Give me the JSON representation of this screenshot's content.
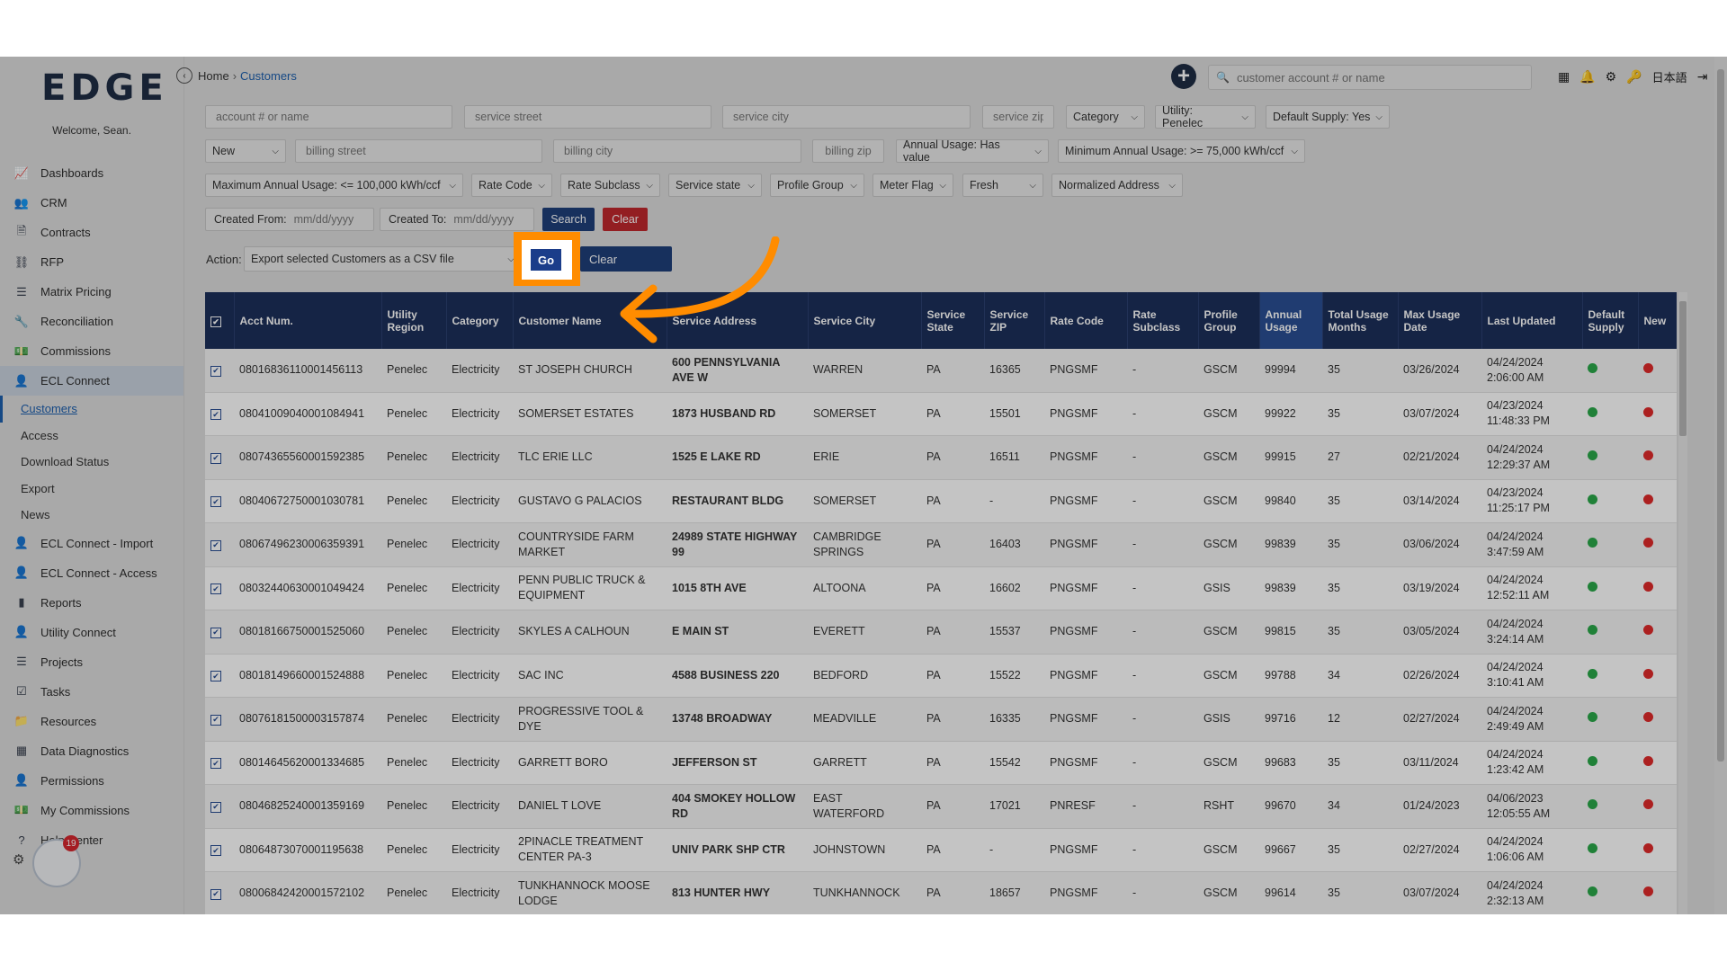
{
  "sidebar": {
    "logo": "EDGE",
    "welcome": "Welcome, Sean.",
    "items": [
      {
        "label": "Dashboards",
        "icon": "chart-icon"
      },
      {
        "label": "CRM",
        "icon": "people-icon"
      },
      {
        "label": "Contracts",
        "icon": "document-icon"
      },
      {
        "label": "RFP",
        "icon": "network-icon"
      },
      {
        "label": "Matrix Pricing",
        "icon": "list-icon"
      },
      {
        "label": "Reconciliation",
        "icon": "wrench-icon"
      },
      {
        "label": "Commissions",
        "icon": "money-icon"
      },
      {
        "label": "ECL Connect",
        "icon": "user-group-icon"
      }
    ],
    "sub_items": [
      "Customers",
      "Access",
      "Download Status",
      "Export",
      "News"
    ],
    "items2": [
      {
        "label": "ECL Connect - Import",
        "icon": "user-group-icon"
      },
      {
        "label": "ECL Connect - Access",
        "icon": "user-group-icon"
      },
      {
        "label": "Reports",
        "icon": "bar-chart-icon"
      },
      {
        "label": "Utility Connect",
        "icon": "user-icon"
      },
      {
        "label": "Projects",
        "icon": "list-icon"
      },
      {
        "label": "Tasks",
        "icon": "check-icon"
      },
      {
        "label": "Resources",
        "icon": "folder-icon"
      },
      {
        "label": "Data Diagnostics",
        "icon": "table-icon"
      },
      {
        "label": "Permissions",
        "icon": "user-lock-icon"
      },
      {
        "label": "My Commissions",
        "icon": "money-icon"
      },
      {
        "label": "Help Center",
        "icon": "question-icon"
      }
    ],
    "notification_count": "19"
  },
  "header": {
    "breadcrumb_home": "Home",
    "breadcrumb_sep": "›",
    "breadcrumb_current": "Customers",
    "search_placeholder": "customer account # or name",
    "language": "日本語"
  },
  "filters": {
    "account_placeholder": "account # or name",
    "service_street_placeholder": "service street",
    "service_city_placeholder": "service city",
    "service_zip_placeholder": "service zip",
    "category": "Category",
    "utility": "Utility: Penelec",
    "default_supply": "Default Supply: Yes",
    "new_select": "New",
    "billing_street_placeholder": "billing street",
    "billing_city_placeholder": "billing city",
    "billing_zip_placeholder": "billing zip",
    "annual_usage": "Annual Usage: Has value",
    "min_annual_usage": "Minimum Annual Usage: >= 75,000 kWh/ccf",
    "max_annual_usage": "Maximum Annual Usage: <= 100,000 kWh/ccf",
    "rate_code": "Rate Code",
    "rate_subclass": "Rate Subclass",
    "service_state": "Service state",
    "profile_group": "Profile Group",
    "meter_flag": "Meter Flag",
    "fresh": "Fresh",
    "normalized_address": "Normalized Address",
    "created_from_label": "Created From:",
    "created_to_label": "Created To:",
    "date_placeholder": "mm/dd/yyyy",
    "search_button": "Search",
    "clear_button": "Clear"
  },
  "action": {
    "label": "Action:",
    "selected": "Export selected Customers as a CSV file",
    "go_button": "Go",
    "clear_button": "Clear"
  },
  "table": {
    "headers": [
      "Acct Num.",
      "Utility Region",
      "Category",
      "Customer Name",
      "Service Address",
      "Service City",
      "Service State",
      "Service ZIP",
      "Rate Code",
      "Rate Subclass",
      "Profile Group",
      "Annual Usage",
      "Total Usage Months",
      "Max Usage Date",
      "Last Updated",
      "Default Supply",
      "New"
    ],
    "rows": [
      {
        "acct": "08016836110001456113",
        "region": "Penelec",
        "category": "Electricity",
        "name": "ST JOSEPH CHURCH",
        "address": "600 PENNSYLVANIA AVE W",
        "city": "WARREN",
        "state": "PA",
        "zip": "16365",
        "rate": "PNGSMF",
        "subclass": "-",
        "profile": "GSCM",
        "usage": "99994",
        "months": "35",
        "max_date": "03/26/2024",
        "updated": "04/24/2024 2:06:00 AM"
      },
      {
        "acct": "08041009040001084941",
        "region": "Penelec",
        "category": "Electricity",
        "name": "SOMERSET ESTATES",
        "address": "1873 HUSBAND RD",
        "city": "SOMERSET",
        "state": "PA",
        "zip": "15501",
        "rate": "PNGSMF",
        "subclass": "-",
        "profile": "GSCM",
        "usage": "99922",
        "months": "35",
        "max_date": "03/07/2024",
        "updated": "04/23/2024 11:48:33 PM"
      },
      {
        "acct": "08074365560001592385",
        "region": "Penelec",
        "category": "Electricity",
        "name": "TLC ERIE LLC",
        "address": "1525 E LAKE RD",
        "city": "ERIE",
        "state": "PA",
        "zip": "16511",
        "rate": "PNGSMF",
        "subclass": "-",
        "profile": "GSCM",
        "usage": "99915",
        "months": "27",
        "max_date": "02/21/2024",
        "updated": "04/24/2024 12:29:37 AM"
      },
      {
        "acct": "08040672750001030781",
        "region": "Penelec",
        "category": "Electricity",
        "name": "GUSTAVO G PALACIOS",
        "address": "RESTAURANT BLDG",
        "city": "SOMERSET",
        "state": "PA",
        "zip": "-",
        "rate": "PNGSMF",
        "subclass": "-",
        "profile": "GSCM",
        "usage": "99840",
        "months": "35",
        "max_date": "03/14/2024",
        "updated": "04/23/2024 11:25:17 PM"
      },
      {
        "acct": "08067496230006359391",
        "region": "Penelec",
        "category": "Electricity",
        "name": "COUNTRYSIDE FARM MARKET",
        "address": "24989 STATE HIGHWAY 99",
        "city": "CAMBRIDGE SPRINGS",
        "state": "PA",
        "zip": "16403",
        "rate": "PNGSMF",
        "subclass": "-",
        "profile": "GSCM",
        "usage": "99839",
        "months": "35",
        "max_date": "03/06/2024",
        "updated": "04/24/2024 3:47:59 AM"
      },
      {
        "acct": "08032440630001049424",
        "region": "Penelec",
        "category": "Electricity",
        "name": "PENN PUBLIC TRUCK & EQUIPMENT",
        "address": "1015 8TH AVE",
        "city": "ALTOONA",
        "state": "PA",
        "zip": "16602",
        "rate": "PNGSMF",
        "subclass": "-",
        "profile": "GSIS",
        "usage": "99839",
        "months": "35",
        "max_date": "03/19/2024",
        "updated": "04/24/2024 12:52:11 AM"
      },
      {
        "acct": "08018166750001525060",
        "region": "Penelec",
        "category": "Electricity",
        "name": "SKYLES A CALHOUN",
        "address": "E MAIN ST",
        "city": "EVERETT",
        "state": "PA",
        "zip": "15537",
        "rate": "PNGSMF",
        "subclass": "-",
        "profile": "GSCM",
        "usage": "99815",
        "months": "35",
        "max_date": "03/05/2024",
        "updated": "04/24/2024 3:24:14 AM"
      },
      {
        "acct": "08018149660001524888",
        "region": "Penelec",
        "category": "Electricity",
        "name": "SAC INC",
        "address": "4588 BUSINESS 220",
        "city": "BEDFORD",
        "state": "PA",
        "zip": "15522",
        "rate": "PNGSMF",
        "subclass": "-",
        "profile": "GSCM",
        "usage": "99788",
        "months": "34",
        "max_date": "02/26/2024",
        "updated": "04/24/2024 3:10:41 AM"
      },
      {
        "acct": "08076181500003157874",
        "region": "Penelec",
        "category": "Electricity",
        "name": "PROGRESSIVE TOOL & DYE",
        "address": "13748 BROADWAY",
        "city": "MEADVILLE",
        "state": "PA",
        "zip": "16335",
        "rate": "PNGSMF",
        "subclass": "-",
        "profile": "GSIS",
        "usage": "99716",
        "months": "12",
        "max_date": "02/27/2024",
        "updated": "04/24/2024 2:49:49 AM"
      },
      {
        "acct": "08014645620001334685",
        "region": "Penelec",
        "category": "Electricity",
        "name": "GARRETT BORO",
        "address": "JEFFERSON ST",
        "city": "GARRETT",
        "state": "PA",
        "zip": "15542",
        "rate": "PNGSMF",
        "subclass": "-",
        "profile": "GSCM",
        "usage": "99683",
        "months": "35",
        "max_date": "03/11/2024",
        "updated": "04/24/2024 1:23:42 AM"
      },
      {
        "acct": "08046825240001359169",
        "region": "Penelec",
        "category": "Electricity",
        "name": "DANIEL T LOVE",
        "address": "404 SMOKEY HOLLOW RD",
        "city": "EAST WATERFORD",
        "state": "PA",
        "zip": "17021",
        "rate": "PNRESF",
        "subclass": "-",
        "profile": "RSHT",
        "usage": "99670",
        "months": "34",
        "max_date": "01/24/2023",
        "updated": "04/06/2023 12:05:55 AM"
      },
      {
        "acct": "08064873070001195638",
        "region": "Penelec",
        "category": "Electricity",
        "name": "2PINACLE TREATMENT CENTER PA-3",
        "address": "UNIV PARK SHP CTR",
        "city": "JOHNSTOWN",
        "state": "PA",
        "zip": "-",
        "rate": "PNGSMF",
        "subclass": "-",
        "profile": "GSCM",
        "usage": "99667",
        "months": "35",
        "max_date": "02/27/2024",
        "updated": "04/24/2024 1:06:06 AM"
      },
      {
        "acct": "08006842420001572102",
        "region": "Penelec",
        "category": "Electricity",
        "name": "TUNKHANNOCK MOOSE LODGE",
        "address": "813 HUNTER HWY",
        "city": "TUNKHANNOCK",
        "state": "PA",
        "zip": "18657",
        "rate": "PNGSMF",
        "subclass": "-",
        "profile": "GSCM",
        "usage": "99614",
        "months": "35",
        "max_date": "03/07/2024",
        "updated": "04/24/2024 2:32:13 AM"
      }
    ]
  },
  "colors": {
    "header_bg": "#1c2f5a",
    "highlight": "#ff8c00",
    "default_supply": "#2aa84a",
    "new_flag": "#e02a2a"
  }
}
